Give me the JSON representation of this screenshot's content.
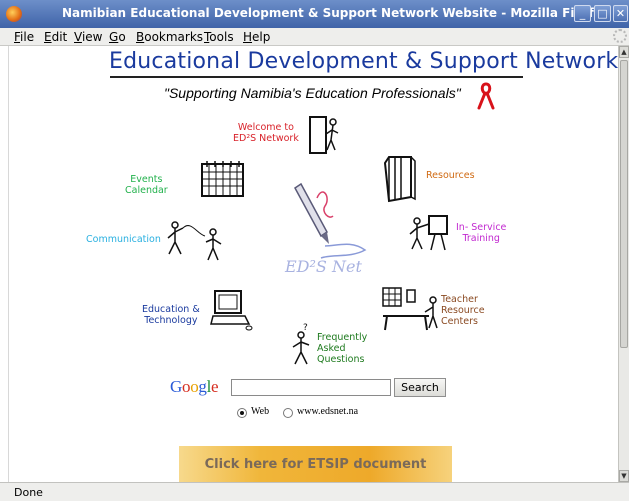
{
  "window": {
    "title": "Namibian Educational Development & Support Network Website - Mozilla Firefox",
    "minimize_glyph": "_",
    "maximize_glyph": "□",
    "close_glyph": "✕"
  },
  "menubar": {
    "items": [
      {
        "key": "F",
        "rest": "ile"
      },
      {
        "key": "E",
        "rest": "dit"
      },
      {
        "key": "V",
        "rest": "iew"
      },
      {
        "key": "G",
        "rest": "o"
      },
      {
        "key": "B",
        "rest": "ookmarks"
      },
      {
        "key": "T",
        "rest": "ools"
      },
      {
        "key": "H",
        "rest": "elp"
      }
    ]
  },
  "page": {
    "site_title": "Educational Development & Support Network",
    "tagline": "\"Supporting Namibia's Education Professionals\"",
    "center_logo_text": "ED²S Net",
    "nav": {
      "welcome": {
        "line1": "Welcome to",
        "line2": "ED²S Network",
        "color": "#d8222a"
      },
      "resources": {
        "line1": "Resources",
        "color": "#d06a12"
      },
      "events": {
        "line1": "Events",
        "line2": "Calendar",
        "color": "#22b14c"
      },
      "inservice": {
        "line1": "In- Service",
        "line2": "Training",
        "color": "#c22ad0"
      },
      "communication": {
        "line1": "Communication",
        "color": "#2ab0e0"
      },
      "edtech": {
        "line1": "Education &",
        "line2": "Technology",
        "color": "#1a3a9e"
      },
      "faq": {
        "line1": "Frequently",
        "line2": "Asked",
        "line3": "Questions",
        "color": "#1e7a1e"
      },
      "trc": {
        "line1": "Teacher",
        "line2": "Resource",
        "line3": "Centers",
        "color": "#8a4a22"
      }
    },
    "search": {
      "google_letters": [
        {
          "ch": "G",
          "color": "#2a5bd7"
        },
        {
          "ch": "o",
          "color": "#d62d20"
        },
        {
          "ch": "o",
          "color": "#e8a100"
        },
        {
          "ch": "g",
          "color": "#2a5bd7"
        },
        {
          "ch": "l",
          "color": "#1e8f3a"
        },
        {
          "ch": "e",
          "color": "#d62d20"
        }
      ],
      "query_value": "",
      "button_label": "Search",
      "options": [
        {
          "label": "Web",
          "selected": true
        },
        {
          "label": "www.edsnet.na",
          "selected": false
        }
      ]
    },
    "etsip_button": "Click here for ETSIP document"
  },
  "status": {
    "text": "Done"
  }
}
